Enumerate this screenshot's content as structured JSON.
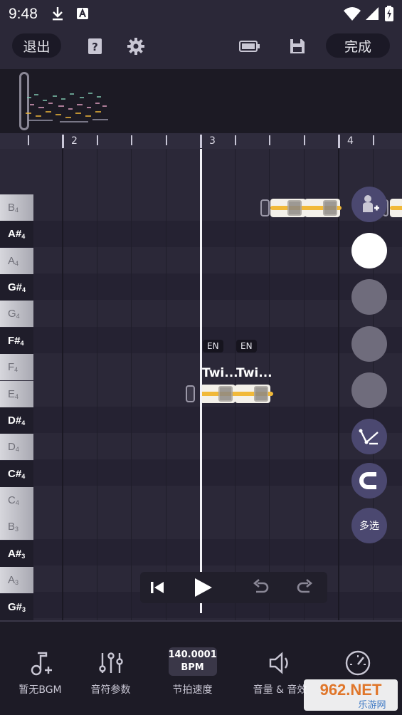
{
  "status_bar": {
    "time": "9:48",
    "icons": [
      "download-icon",
      "font-a-icon",
      "wifi-icon",
      "signal-icon",
      "battery-icon"
    ]
  },
  "toolbar": {
    "exit_label": "退出",
    "done_label": "完成",
    "icons": [
      "help-book-icon",
      "settings-gear-icon",
      "battery-mode-icon",
      "save-icon"
    ]
  },
  "ruler": {
    "measures": [
      "2",
      "3",
      "4"
    ]
  },
  "piano_keys": [
    {
      "note": "B",
      "octave": "4",
      "type": "white"
    },
    {
      "note": "A#",
      "octave": "4",
      "type": "black"
    },
    {
      "note": "A",
      "octave": "4",
      "type": "white"
    },
    {
      "note": "G#",
      "octave": "4",
      "type": "black"
    },
    {
      "note": "G",
      "octave": "4",
      "type": "white"
    },
    {
      "note": "F#",
      "octave": "4",
      "type": "black"
    },
    {
      "note": "F",
      "octave": "4",
      "type": "white"
    },
    {
      "note": "E",
      "octave": "4",
      "type": "white"
    },
    {
      "note": "D#",
      "octave": "4",
      "type": "black"
    },
    {
      "note": "D",
      "octave": "4",
      "type": "white"
    },
    {
      "note": "C#",
      "octave": "4",
      "type": "black"
    },
    {
      "note": "C",
      "octave": "4",
      "type": "white"
    },
    {
      "note": "B",
      "octave": "3",
      "type": "white"
    },
    {
      "note": "A#",
      "octave": "3",
      "type": "black"
    },
    {
      "note": "A",
      "octave": "3",
      "type": "white"
    },
    {
      "note": "G#",
      "octave": "3",
      "type": "black"
    }
  ],
  "notes": {
    "lang_tag": "EN",
    "lyric_1": "Twi...",
    "lyric_2": "Twi..."
  },
  "side_buttons": {
    "multi_select_label": "多选"
  },
  "bottom_bar": {
    "bgm_label": "暂无BGM",
    "note_params_label": "音符参数",
    "bpm_value": "140.0001",
    "bpm_unit": "BPM",
    "tempo_label": "节拍速度",
    "volume_label": "音量 & 音效",
    "last_label": ""
  },
  "watermark": {
    "text": "962.NET",
    "subtext": "乐游网"
  },
  "colors": {
    "background": "#2b2838",
    "note_bar": "#f1b939",
    "accent_purple": "#4b4870"
  }
}
